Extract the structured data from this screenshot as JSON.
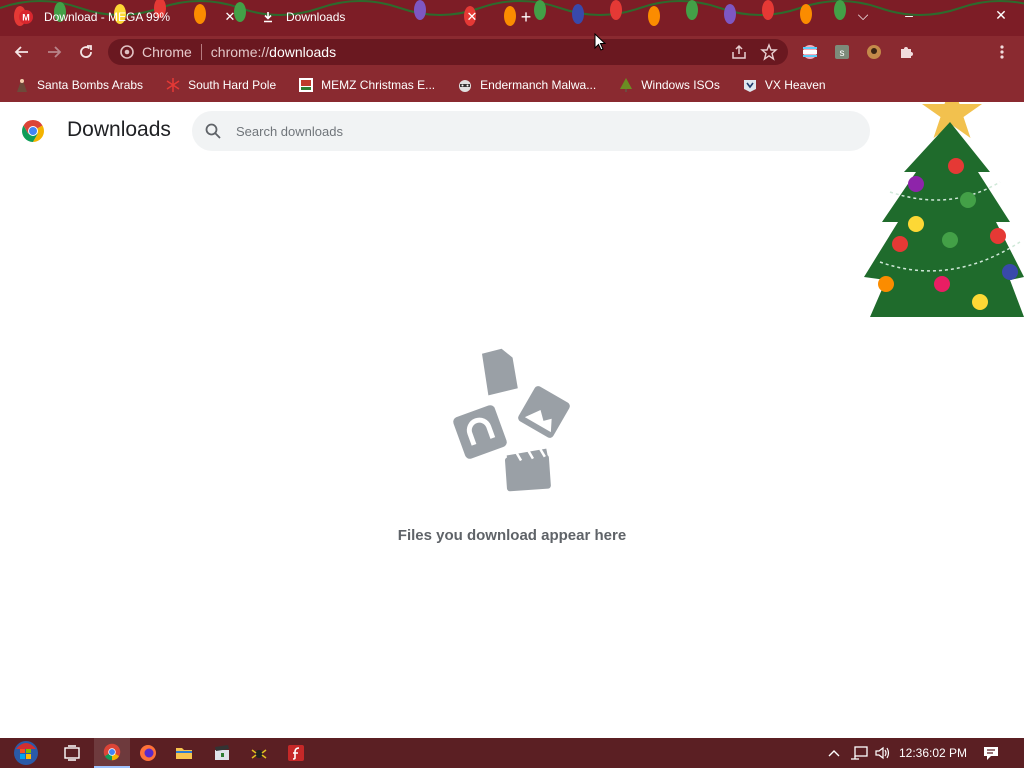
{
  "tabs": [
    {
      "title": "Download - MEGA 99%",
      "icon": "mega-icon",
      "close": "✕"
    },
    {
      "title": "Downloads",
      "icon": "download-icon",
      "close": "✕"
    }
  ],
  "new_tab": "+",
  "window_controls": {
    "tab_search": "⌵",
    "minimize": "–",
    "close": "✕"
  },
  "omnibox": {
    "site_label": "Chrome",
    "url_prefix": "chrome://",
    "url_path": "downloads"
  },
  "bookmarks": [
    {
      "label": "Santa Bombs Arabs",
      "icon": "santa-icon"
    },
    {
      "label": "South Hard Pole",
      "icon": "snowflake-icon"
    },
    {
      "label": "MEMZ Christmas E...",
      "icon": "memz-icon"
    },
    {
      "label": "Endermanch Malwa...",
      "icon": "raccoon-icon"
    },
    {
      "label": "Windows ISOs",
      "icon": "tree-icon"
    },
    {
      "label": "VX Heaven",
      "icon": "vx-icon"
    }
  ],
  "page": {
    "title": "Downloads",
    "search_placeholder": "Search downloads",
    "empty_message": "Files you download appear here"
  },
  "taskbar": {
    "apps": [
      "start-orb",
      "task-view",
      "chrome",
      "firefox",
      "file-explorer",
      "clapper-app",
      "spider-app",
      "flash-app"
    ],
    "tray_up": "^",
    "time": "12:36:02 PM"
  },
  "colors": {
    "tabstrip": "#7d1d26",
    "toolbar": "#8a2a30",
    "omnibox": "#6a1820",
    "taskbar": "#5b1f23",
    "empty_icon": "#9aa0a6"
  }
}
